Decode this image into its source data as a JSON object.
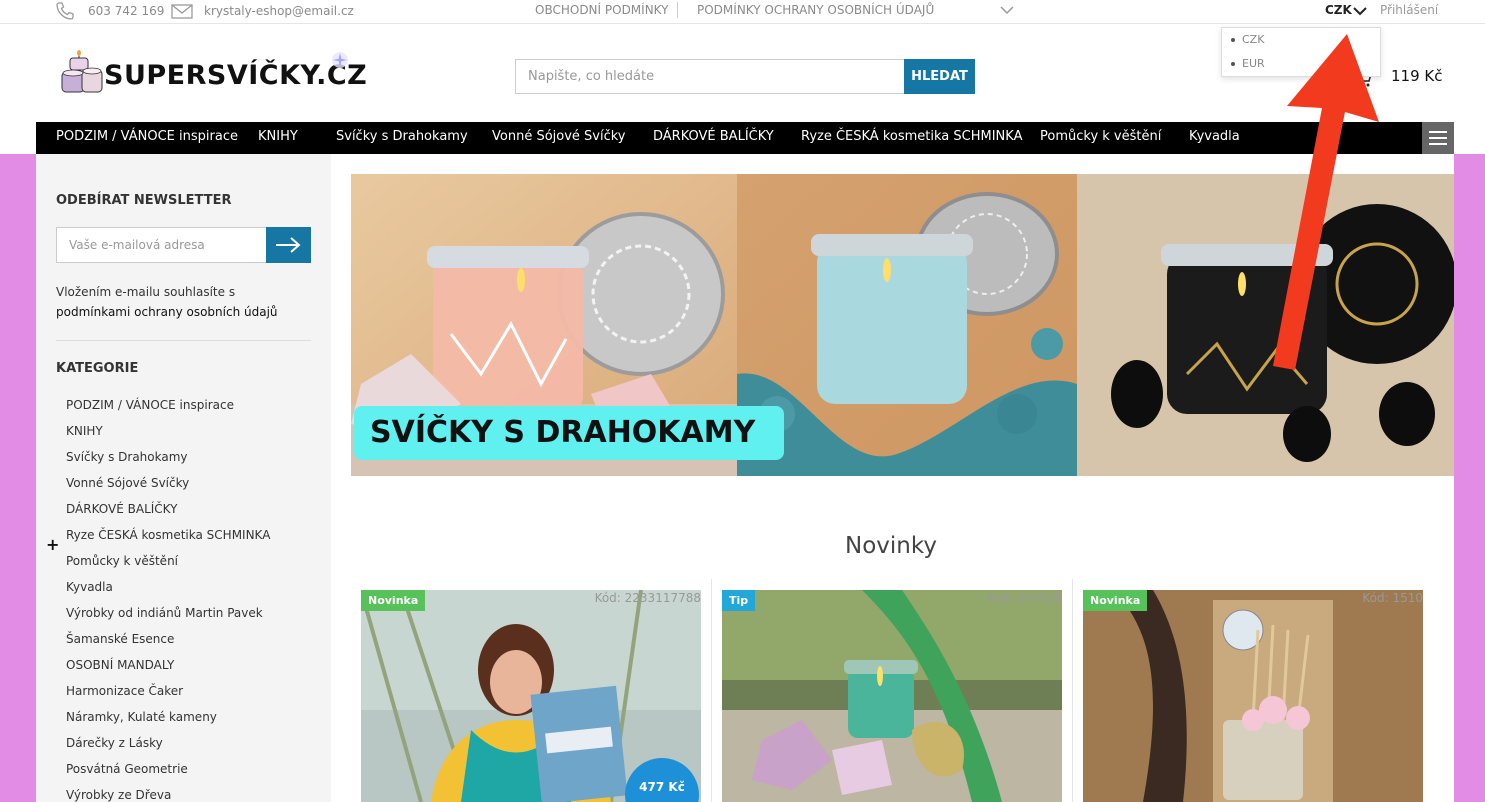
{
  "topbar": {
    "phone": "603 742 169",
    "email": "krystaly-eshop@email.cz",
    "links": [
      "OBCHODNÍ PODMÍNKY",
      "PODMÍNKY OCHRANY OSOBNÍCH ÚDAJŮ"
    ],
    "currency": "CZK",
    "login": "Přihlášení"
  },
  "currency_dropdown": {
    "options": [
      "CZK",
      "EUR"
    ]
  },
  "header": {
    "logo_text": "SUPERSVÍČKY.CZ",
    "search_placeholder": "Napište, co hledáte",
    "search_button": "HLEDAT",
    "cart_total": "119 Kč"
  },
  "nav": {
    "items": [
      "PODZIM / VÁNOCE inspirace",
      "KNIHY",
      "Svíčky s Drahokamy",
      "Vonné Sójové Svíčky",
      "DÁRKOVÉ BALÍČKY",
      "Ryze ČESKÁ kosmetika SCHMINKA",
      "Pomůcky k věštění",
      "Kyvadla"
    ]
  },
  "sidebar": {
    "newsletter_title": "ODEBÍRAT NEWSLETTER",
    "newsletter_placeholder": "Vaše e-mailová adresa",
    "newsletter_note": "Vložením e-mailu souhlasíte s",
    "newsletter_link": "podmínkami ochrany osobních údajů",
    "categories_title": "KATEGORIE",
    "categories": [
      "PODZIM / VÁNOCE inspirace",
      "KNIHY",
      "Svíčky s Drahokamy",
      "Vonné Sójové Svíčky",
      "DÁRKOVÉ BALÍČKY",
      "Ryze ČESKÁ kosmetika SCHMINKA",
      "Pomůcky k věštění",
      "Kyvadla",
      "Výrobky od indiánů Martin Pavek",
      "Šamanské Esence",
      "OSOBNÍ MANDALY",
      "Harmonizace Čaker",
      "Náramky, Kulaté kameny",
      "Dárečky z Lásky",
      "Posvátná Geometrie",
      "Výrobky ze Dřeva"
    ]
  },
  "banner": {
    "caption": "SVÍČKY S DRAHOKAMY"
  },
  "novinky": {
    "title": "Novinky",
    "products": [
      {
        "badge": "Novinka",
        "badge_color": "#57c15a",
        "code": "Kód: 2233117788",
        "price": "477 Kč"
      },
      {
        "badge": "Tip",
        "badge_color": "#23a7d8",
        "code": "Kód: 998928"
      },
      {
        "badge": "Novinka",
        "badge_color": "#57c15a",
        "code": "Kód: 1510"
      }
    ]
  },
  "colors": {
    "accent": "#1677a5",
    "band": "#e28ce6",
    "arrow": "#f23a1f"
  }
}
